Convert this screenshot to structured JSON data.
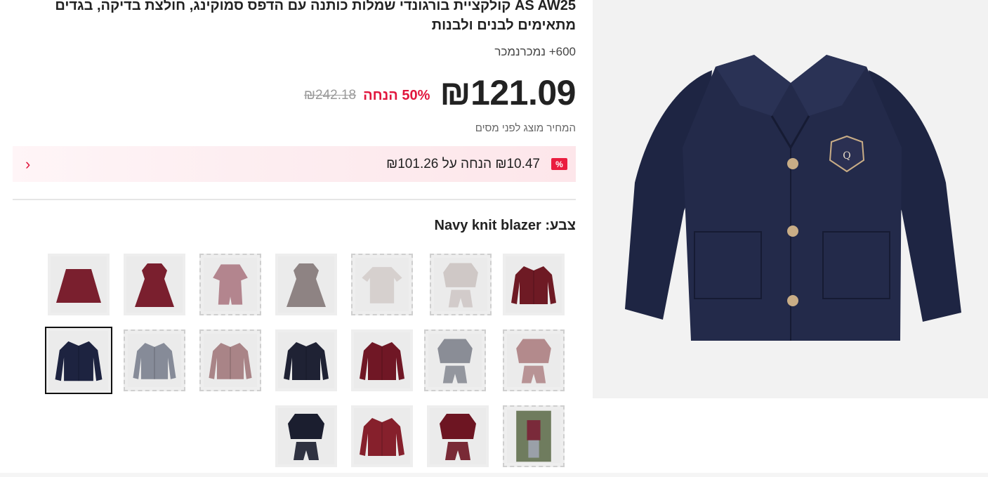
{
  "product": {
    "title": "AS AW25 קולקציית בורגונדי שמלות כותנה עם הדפס סמוקינג, חולצת בדיקה, בגדים מתאימים לבנים ולבנות",
    "sold": "600+ נמכרנמכר",
    "price": "₪121.09",
    "discount": "50% הנחה",
    "old_price": "₪242.18",
    "tax_note": "המחיר מוצג לפני מסים"
  },
  "coupon": {
    "icon": "%",
    "text": "₪10.47 הנחה על ₪101.26"
  },
  "color": {
    "label": "צבע: Navy knit blazer"
  },
  "swatches": [
    {
      "name": "burgundy-cardigan",
      "kind": "cardigan",
      "color": "#6e1a24"
    },
    {
      "name": "plaid-shirt-set",
      "kind": "set",
      "color": "#cfc8c6"
    },
    {
      "name": "plaid-shirt",
      "kind": "shirt",
      "color": "#d6d0ce"
    },
    {
      "name": "plaid-dress",
      "kind": "dress",
      "color": "#8e8383"
    },
    {
      "name": "floral-romper",
      "kind": "romper",
      "color": "#b3858e"
    },
    {
      "name": "floral-dress",
      "kind": "dress",
      "color": "#7a1f2e"
    },
    {
      "name": "floral-skirt",
      "kind": "skirt",
      "color": "#7a1f2e"
    },
    {
      "name": "mauve-sweater-set",
      "kind": "set",
      "color": "#b38a8c"
    },
    {
      "name": "grey-sweater-set",
      "kind": "set",
      "color": "#8a8d96"
    },
    {
      "name": "burgundy-cardigan-plain",
      "kind": "cardigan",
      "color": "#701725"
    },
    {
      "name": "navy-cardigan-plain",
      "kind": "cardigan",
      "color": "#1f2234"
    },
    {
      "name": "mauve-cardigan",
      "kind": "cardigan",
      "color": "#a98487"
    },
    {
      "name": "grey-cardigan",
      "kind": "cardigan",
      "color": "#868b98"
    },
    {
      "name": "navy-knit-blazer",
      "kind": "cardigan",
      "color": "#1d2340"
    },
    {
      "name": "model-photo",
      "kind": "photo",
      "color": "#7a2a3a"
    },
    {
      "name": "burgundy-cardigan-skirt",
      "kind": "set",
      "color": "#6d1522"
    },
    {
      "name": "burgundy-sweater",
      "kind": "cardigan",
      "color": "#86202c"
    },
    {
      "name": "navy-cardigan-skirt",
      "kind": "set",
      "color": "#1b1e2f"
    }
  ],
  "colors": {
    "accent": "#e1163d",
    "navy": "#1d2340"
  }
}
